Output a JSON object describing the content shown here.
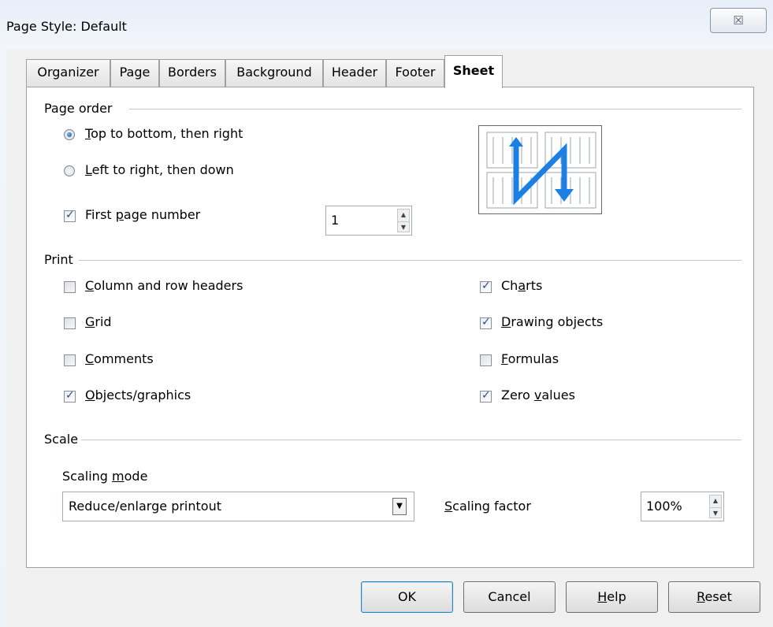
{
  "window": {
    "title": "Page Style: Default",
    "close_label": "☒"
  },
  "tabs": [
    {
      "label": "Organizer",
      "active": false
    },
    {
      "label": "Page",
      "active": false
    },
    {
      "label": "Borders",
      "active": false
    },
    {
      "label": "Background",
      "active": false
    },
    {
      "label": "Header",
      "active": false
    },
    {
      "label": "Footer",
      "active": false
    },
    {
      "label": "Sheet",
      "active": true
    }
  ],
  "page_order": {
    "title": "Page order",
    "option_top_to_bottom": {
      "mnemonic": "T",
      "rest": "op to bottom, then right",
      "checked": true
    },
    "option_left_to_right": {
      "mnemonic": "L",
      "rest": "eft to right, then down",
      "checked": false
    },
    "first_page_number": {
      "before": "First ",
      "mnemonic": "p",
      "after": "age number",
      "checked": true,
      "value": "1"
    }
  },
  "print": {
    "title": "Print",
    "column_row_headers": {
      "before": "",
      "mnemonic": "C",
      "after": "olumn and row headers",
      "checked": false
    },
    "grid": {
      "before": "",
      "mnemonic": "G",
      "after": "rid",
      "checked": false
    },
    "comments": {
      "before": "",
      "mnemonic": "C",
      "after": "omments",
      "checked": false
    },
    "objects_graphics": {
      "before": "",
      "mnemonic": "O",
      "after": "bjects/graphics",
      "checked": true
    },
    "charts": {
      "before": "Ch",
      "mnemonic": "a",
      "after": "rts",
      "checked": true
    },
    "drawing_objects": {
      "before": "",
      "mnemonic": "D",
      "after": "rawing objects",
      "checked": true
    },
    "formulas": {
      "before": "",
      "mnemonic": "F",
      "after": "ormulas",
      "checked": false
    },
    "zero_values": {
      "before": "Zero ",
      "mnemonic": "v",
      "after": "alues",
      "checked": true
    }
  },
  "scale": {
    "title": "Scale",
    "mode_label": {
      "before": "Scaling ",
      "mnemonic": "m",
      "after": "ode"
    },
    "mode_value": "Reduce/enlarge printout",
    "factor_label": {
      "before": "",
      "mnemonic": "S",
      "after": "caling factor"
    },
    "factor_value": "100%"
  },
  "buttons": {
    "ok": {
      "before": "OK",
      "mnemonic": "",
      "after": ""
    },
    "cancel": {
      "before": "Cancel",
      "mnemonic": "",
      "after": ""
    },
    "help": {
      "before": "",
      "mnemonic": "H",
      "after": "elp"
    },
    "reset": {
      "before": "",
      "mnemonic": "R",
      "after": "eset"
    }
  },
  "colors": {
    "arrow": "#1c7fe3",
    "panel_border": "#a0a0a0"
  }
}
